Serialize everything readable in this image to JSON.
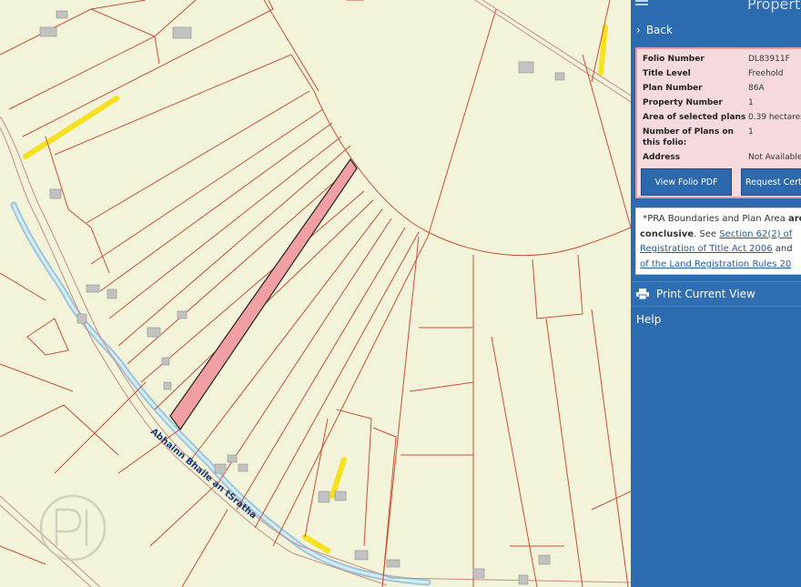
{
  "panel": {
    "title": "Propert",
    "back_label": "Back",
    "info": [
      {
        "label": "Folio Number",
        "value": "DL83911F"
      },
      {
        "label": "Title Level",
        "value": "Freehold"
      },
      {
        "label": "Plan Number",
        "value": "86A"
      },
      {
        "label": "Property Number",
        "value": "1"
      },
      {
        "label": "Area of selected plans",
        "value": "0.39 hectares."
      },
      {
        "label": "Number of Plans on",
        "label2": "this folio:",
        "value": "1"
      },
      {
        "label": "Address",
        "value": "Not Available"
      }
    ],
    "buttons": {
      "view_pdf": "View Folio PDF",
      "request_cert": "Request Certi"
    },
    "note": {
      "text1": "*PRA Boundaries and Plan Area ",
      "bold1": "are n",
      "bold2": "conclusive",
      "text2": ". See ",
      "link1": "Section 62(2) of",
      "link2": "Registration of Title Act 2006",
      "text3": " and",
      "link3": "of the Land Registration Rules 20"
    },
    "print_label": "Print Current View",
    "help_label": "Help"
  },
  "map": {
    "river_label": "Abhainn Bhaile an tSratha",
    "colors": {
      "background": "#f2f3d8",
      "boundary": "#c8503a",
      "selected_fill": "#f0a0a3",
      "road_highlight": "#f5e11d",
      "river": "#9cc6dc"
    }
  }
}
